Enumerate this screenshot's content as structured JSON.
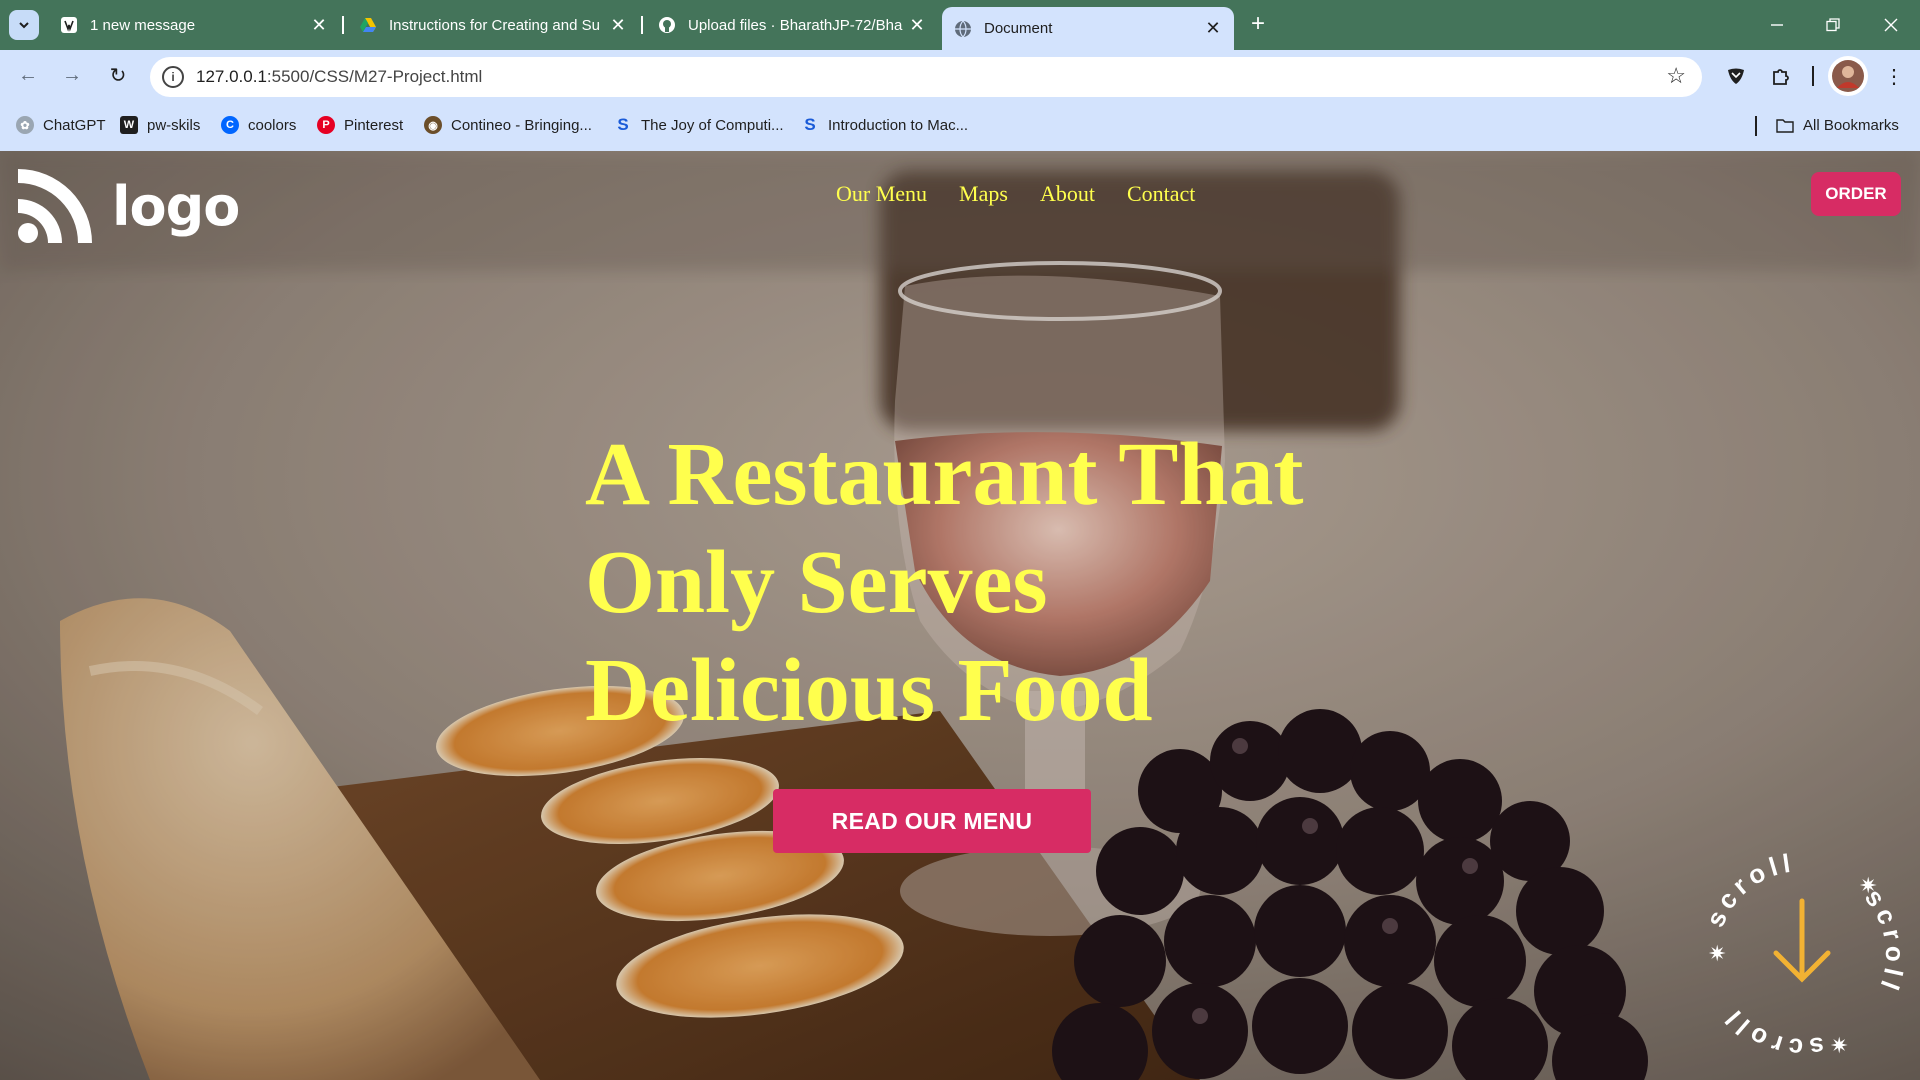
{
  "browser": {
    "tabs": [
      {
        "title": "1 new message",
        "icon": "wordpress-icon"
      },
      {
        "title": "Instructions for Creating and Su",
        "icon": "google-drive-icon"
      },
      {
        "title": "Upload files · BharathJP-72/Bha",
        "icon": "github-icon"
      },
      {
        "title": "Document",
        "icon": "globe-icon",
        "active": true
      }
    ],
    "url_host": "127.0.0.1",
    "url_path": ":5500/CSS/M27-Project.html",
    "bookmarks": [
      {
        "label": "ChatGPT",
        "icon": "chatgpt-icon"
      },
      {
        "label": "pw-skils",
        "icon": "pw-icon"
      },
      {
        "label": "coolors",
        "icon": "coolors-icon"
      },
      {
        "label": "Pinterest",
        "icon": "pinterest-icon"
      },
      {
        "label": "Contineo - Bringing...",
        "icon": "contineo-icon"
      },
      {
        "label": "The Joy of Computi...",
        "icon": "swayam-icon"
      },
      {
        "label": "Introduction to Mac...",
        "icon": "swayam-icon"
      }
    ],
    "all_bookmarks": "All Bookmarks"
  },
  "site": {
    "logo_text": "logo",
    "nav": [
      "Our Menu",
      "Maps",
      "About",
      "Contact"
    ],
    "order_label": "ORDER",
    "hero_lines": [
      "A Restaurant That",
      "Only Serves",
      "Delicious Food"
    ],
    "cta_label": "READ OUR MENU",
    "scroll_text": "scroll",
    "colors": {
      "accent": "#d72c64",
      "headline": "#ffff4d",
      "arrow": "#f2b233"
    }
  }
}
